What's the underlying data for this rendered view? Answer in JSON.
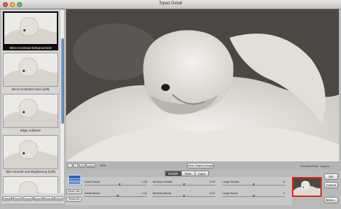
{
  "window": {
    "title": "Topaz Detail"
  },
  "sidebar": {
    "thumbnails": [
      {
        "label": "Micro-Contrast Enhancement",
        "selected": true
      },
      {
        "label": "Micro-Contrast Color (soft)",
        "selected": false
      },
      {
        "label": "Edge Softener",
        "selected": false
      },
      {
        "label": "Skin Smooth and Brightening (soft)",
        "selected": false
      },
      {
        "label": "",
        "selected": false
      }
    ],
    "buttons": [
      "Default",
      "Presets",
      "Import",
      "Export",
      "Search",
      "Delete"
    ]
  },
  "toolbar": {
    "zoom_out": "-",
    "zoom_in": "+",
    "fit": "Fit",
    "zoom_100": "100%",
    "zoom_value": "33%",
    "view_original": "View Original Image",
    "preview_mode_label": "Preview Mode",
    "preview_mode_value": "Approx."
  },
  "tabs": [
    {
      "label": "Details",
      "active": true
    },
    {
      "label": "Tone",
      "active": false
    },
    {
      "label": "Color",
      "active": false
    }
  ],
  "controls": {
    "reset_tab": "Reset Tab",
    "reset_all": "Reset All",
    "sliders": [
      {
        "label": "Small Detail",
        "value": "0.25",
        "level": 0.56
      },
      {
        "label": "Medium Details",
        "value": "0.00",
        "level": 0.5
      },
      {
        "label": "Large Details",
        "value": "0",
        "level": 0.5
      },
      {
        "label": "Small Boost",
        "value": "0.11",
        "level": 0.53
      },
      {
        "label": "Medium Boost",
        "value": "0.01",
        "level": 0.5
      },
      {
        "label": "Large Boost",
        "value": "0",
        "level": 0.5
      }
    ]
  },
  "actions": {
    "ok": "OK",
    "cancel": "Cancel",
    "menu": "Menu..."
  },
  "colors": {
    "selected_preview_border": "#d02a22",
    "background": "#4b4844"
  }
}
